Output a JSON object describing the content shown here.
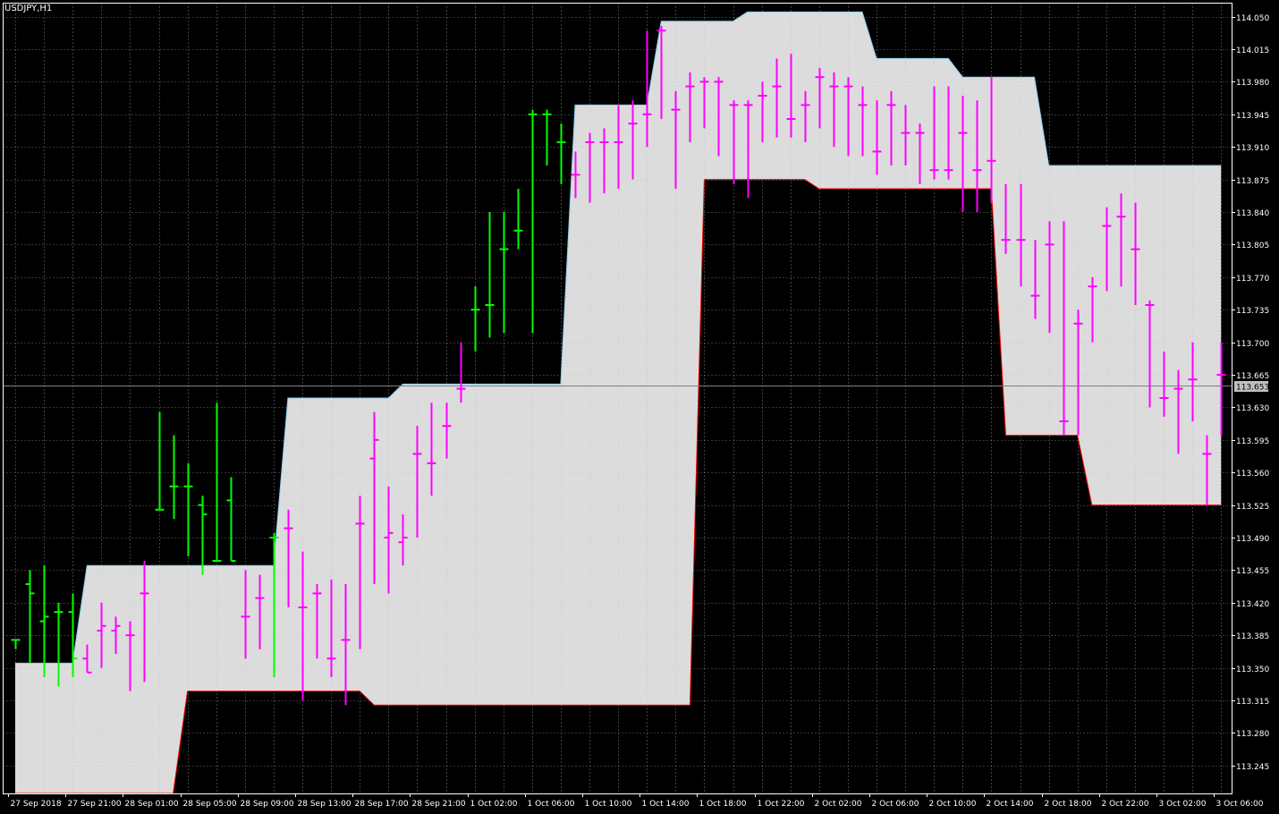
{
  "chart_data": {
    "type": "ohlc",
    "symbol_label": "USDJPY,H1",
    "current_price": 113.653,
    "current_price_label": "113.653",
    "ylim": [
      113.215,
      114.065
    ],
    "y_ticks": [
      "114.050",
      "114.015",
      "113.980",
      "113.945",
      "113.910",
      "113.875",
      "113.840",
      "113.805",
      "113.770",
      "113.735",
      "113.700",
      "113.665",
      "113.630",
      "113.595",
      "113.560",
      "113.525",
      "113.490",
      "113.455",
      "113.420",
      "113.385",
      "113.350",
      "113.315",
      "113.280",
      "113.245"
    ],
    "x_ticks": [
      {
        "bar": 0,
        "label": "27 Sep 2018"
      },
      {
        "bar": 4,
        "label": "27 Sep 21:00"
      },
      {
        "bar": 8,
        "label": "28 Sep 01:00"
      },
      {
        "bar": 12,
        "label": "28 Sep 05:00"
      },
      {
        "bar": 16,
        "label": "28 Sep 09:00"
      },
      {
        "bar": 20,
        "label": "28 Sep 13:00"
      },
      {
        "bar": 24,
        "label": "28 Sep 17:00"
      },
      {
        "bar": 28,
        "label": "28 Sep 21:00"
      },
      {
        "bar": 32,
        "label": "1 Oct 02:00"
      },
      {
        "bar": 36,
        "label": "1 Oct 06:00"
      },
      {
        "bar": 40,
        "label": "1 Oct 10:00"
      },
      {
        "bar": 44,
        "label": "1 Oct 14:00"
      },
      {
        "bar": 48,
        "label": "1 Oct 18:00"
      },
      {
        "bar": 52,
        "label": "1 Oct 22:00"
      },
      {
        "bar": 56,
        "label": "2 Oct 02:00"
      },
      {
        "bar": 60,
        "label": "2 Oct 06:00"
      },
      {
        "bar": 64,
        "label": "2 Oct 10:00"
      },
      {
        "bar": 68,
        "label": "2 Oct 14:00"
      },
      {
        "bar": 72,
        "label": "2 Oct 18:00"
      },
      {
        "bar": 76,
        "label": "2 Oct 22:00"
      },
      {
        "bar": 80,
        "label": "3 Oct 02:00"
      },
      {
        "bar": 84,
        "label": "3 Oct 06:00"
      }
    ],
    "colors": {
      "background": "#000000",
      "grid": "#c0c0c0",
      "band_fill": "#dcdcdc",
      "band_upper_line": "#87ceeb",
      "band_lower_line": "#ff0000",
      "bar_outside": "#00ff00",
      "bar_inside": "#ff00ff",
      "price_line": "#808080",
      "price_tag_bg": "#c0c0c0",
      "text": "#ffffff"
    },
    "bars": [
      {
        "o": 113.38,
        "h": 113.38,
        "l": 113.37,
        "c": 113.38
      },
      {
        "o": 113.44,
        "h": 113.455,
        "l": 113.355,
        "c": 113.43
      },
      {
        "o": 113.4,
        "h": 113.46,
        "l": 113.34,
        "c": 113.405
      },
      {
        "o": 113.41,
        "h": 113.42,
        "l": 113.33,
        "c": 113.41
      },
      {
        "o": 113.41,
        "h": 113.43,
        "l": 113.34,
        "c": 113.36
      },
      {
        "o": 113.36,
        "h": 113.375,
        "l": 113.345,
        "c": 113.345
      },
      {
        "o": 113.39,
        "h": 113.42,
        "l": 113.35,
        "c": 113.395
      },
      {
        "o": 113.39,
        "h": 113.405,
        "l": 113.365,
        "c": 113.395
      },
      {
        "o": 113.385,
        "h": 113.4,
        "l": 113.325,
        "c": 113.385
      },
      {
        "o": 113.43,
        "h": 113.465,
        "l": 113.335,
        "c": 113.43
      },
      {
        "o": 113.52,
        "h": 113.625,
        "l": 113.52,
        "c": 113.52
      },
      {
        "o": 113.545,
        "h": 113.6,
        "l": 113.51,
        "c": 113.545
      },
      {
        "o": 113.545,
        "h": 113.57,
        "l": 113.47,
        "c": 113.545
      },
      {
        "o": 113.525,
        "h": 113.535,
        "l": 113.45,
        "c": 113.515
      },
      {
        "o": 113.465,
        "h": 113.635,
        "l": 113.465,
        "c": 113.465
      },
      {
        "o": 113.53,
        "h": 113.555,
        "l": 113.465,
        "c": 113.465
      },
      {
        "o": 113.405,
        "h": 113.455,
        "l": 113.36,
        "c": 113.405
      },
      {
        "o": 113.425,
        "h": 113.45,
        "l": 113.37,
        "c": 113.425
      },
      {
        "o": 113.49,
        "h": 113.495,
        "l": 113.34,
        "c": 113.49
      },
      {
        "o": 113.5,
        "h": 113.52,
        "l": 113.415,
        "c": 113.5
      },
      {
        "o": 113.415,
        "h": 113.475,
        "l": 113.315,
        "c": 113.415
      },
      {
        "o": 113.43,
        "h": 113.44,
        "l": 113.36,
        "c": 113.43
      },
      {
        "o": 113.36,
        "h": 113.445,
        "l": 113.34,
        "c": 113.36
      },
      {
        "o": 113.38,
        "h": 113.44,
        "l": 113.31,
        "c": 113.38
      },
      {
        "o": 113.505,
        "h": 113.535,
        "l": 113.37,
        "c": 113.505
      },
      {
        "o": 113.575,
        "h": 113.625,
        "l": 113.44,
        "c": 113.595
      },
      {
        "o": 113.49,
        "h": 113.545,
        "l": 113.43,
        "c": 113.495
      },
      {
        "o": 113.485,
        "h": 113.515,
        "l": 113.46,
        "c": 113.49
      },
      {
        "o": 113.58,
        "h": 113.61,
        "l": 113.49,
        "c": 113.58
      },
      {
        "o": 113.57,
        "h": 113.635,
        "l": 113.535,
        "c": 113.57
      },
      {
        "o": 113.61,
        "h": 113.635,
        "l": 113.575,
        "c": 113.61
      },
      {
        "o": 113.65,
        "h": 113.7,
        "l": 113.635,
        "c": 113.65
      },
      {
        "o": 113.735,
        "h": 113.76,
        "l": 113.69,
        "c": 113.735
      },
      {
        "o": 113.74,
        "h": 113.84,
        "l": 113.705,
        "c": 113.74
      },
      {
        "o": 113.8,
        "h": 113.84,
        "l": 113.71,
        "c": 113.8
      },
      {
        "o": 113.82,
        "h": 113.865,
        "l": 113.8,
        "c": 113.82
      },
      {
        "o": 113.945,
        "h": 113.95,
        "l": 113.71,
        "c": 113.945
      },
      {
        "o": 113.945,
        "h": 113.95,
        "l": 113.89,
        "c": 113.945
      },
      {
        "o": 113.915,
        "h": 113.935,
        "l": 113.87,
        "c": 113.915
      },
      {
        "o": 113.88,
        "h": 113.905,
        "l": 113.855,
        "c": 113.88
      },
      {
        "o": 113.915,
        "h": 113.925,
        "l": 113.85,
        "c": 113.915
      },
      {
        "o": 113.915,
        "h": 113.93,
        "l": 113.86,
        "c": 113.915
      },
      {
        "o": 113.915,
        "h": 113.955,
        "l": 113.865,
        "c": 113.915
      },
      {
        "o": 113.935,
        "h": 113.96,
        "l": 113.875,
        "c": 113.935
      },
      {
        "o": 113.945,
        "h": 114.035,
        "l": 113.91,
        "c": 113.945
      },
      {
        "o": 114.035,
        "h": 114.04,
        "l": 113.94,
        "c": 114.035
      },
      {
        "o": 113.95,
        "h": 113.97,
        "l": 113.865,
        "c": 113.95
      },
      {
        "o": 113.975,
        "h": 113.99,
        "l": 113.915,
        "c": 113.975
      },
      {
        "o": 113.98,
        "h": 113.985,
        "l": 113.93,
        "c": 113.98
      },
      {
        "o": 113.98,
        "h": 113.985,
        "l": 113.9,
        "c": 113.98
      },
      {
        "o": 113.955,
        "h": 113.96,
        "l": 113.87,
        "c": 113.955
      },
      {
        "o": 113.955,
        "h": 113.96,
        "l": 113.855,
        "c": 113.955
      },
      {
        "o": 113.965,
        "h": 113.98,
        "l": 113.915,
        "c": 113.965
      },
      {
        "o": 113.975,
        "h": 114.005,
        "l": 113.92,
        "c": 113.975
      },
      {
        "o": 113.94,
        "h": 114.01,
        "l": 113.92,
        "c": 113.94
      },
      {
        "o": 113.955,
        "h": 113.97,
        "l": 113.915,
        "c": 113.955
      },
      {
        "o": 113.985,
        "h": 113.995,
        "l": 113.93,
        "c": 113.985
      },
      {
        "o": 113.975,
        "h": 113.99,
        "l": 113.91,
        "c": 113.975
      },
      {
        "o": 113.975,
        "h": 113.985,
        "l": 113.9,
        "c": 113.975
      },
      {
        "o": 113.955,
        "h": 113.975,
        "l": 113.9,
        "c": 113.955
      },
      {
        "o": 113.905,
        "h": 113.96,
        "l": 113.88,
        "c": 113.905
      },
      {
        "o": 113.955,
        "h": 113.97,
        "l": 113.89,
        "c": 113.955
      },
      {
        "o": 113.925,
        "h": 113.955,
        "l": 113.89,
        "c": 113.925
      },
      {
        "o": 113.925,
        "h": 113.935,
        "l": 113.87,
        "c": 113.925
      },
      {
        "o": 113.885,
        "h": 113.975,
        "l": 113.875,
        "c": 113.885
      },
      {
        "o": 113.885,
        "h": 113.975,
        "l": 113.875,
        "c": 113.885
      },
      {
        "o": 113.925,
        "h": 113.965,
        "l": 113.84,
        "c": 113.925
      },
      {
        "o": 113.885,
        "h": 113.96,
        "l": 113.84,
        "c": 113.885
      },
      {
        "o": 113.895,
        "h": 113.985,
        "l": 113.85,
        "c": 113.895
      },
      {
        "o": 113.81,
        "h": 113.87,
        "l": 113.795,
        "c": 113.81
      },
      {
        "o": 113.81,
        "h": 113.87,
        "l": 113.76,
        "c": 113.81
      },
      {
        "o": 113.75,
        "h": 113.81,
        "l": 113.725,
        "c": 113.75
      },
      {
        "o": 113.805,
        "h": 113.83,
        "l": 113.71,
        "c": 113.805
      },
      {
        "o": 113.615,
        "h": 113.83,
        "l": 113.6,
        "c": 113.615
      },
      {
        "o": 113.72,
        "h": 113.735,
        "l": 113.6,
        "c": 113.72
      },
      {
        "o": 113.76,
        "h": 113.77,
        "l": 113.7,
        "c": 113.76
      },
      {
        "o": 113.825,
        "h": 113.845,
        "l": 113.755,
        "c": 113.825
      },
      {
        "o": 113.835,
        "h": 113.86,
        "l": 113.76,
        "c": 113.835
      },
      {
        "o": 113.8,
        "h": 113.85,
        "l": 113.74,
        "c": 113.8
      },
      {
        "o": 113.74,
        "h": 113.745,
        "l": 113.63,
        "c": 113.74
      },
      {
        "o": 113.64,
        "h": 113.69,
        "l": 113.62,
        "c": 113.64
      },
      {
        "o": 113.65,
        "h": 113.67,
        "l": 113.58,
        "c": 113.65
      },
      {
        "o": 113.66,
        "h": 113.7,
        "l": 113.615,
        "c": 113.66
      },
      {
        "o": 113.58,
        "h": 113.6,
        "l": 113.525,
        "c": 113.58
      },
      {
        "o": 113.665,
        "h": 113.7,
        "l": 113.6,
        "c": 113.665
      }
    ],
    "band": {
      "upper": [
        [
          0,
          113.355
        ],
        [
          4,
          113.355
        ],
        [
          5,
          113.46
        ],
        [
          18,
          113.46
        ],
        [
          19,
          113.64
        ],
        [
          26,
          113.64
        ],
        [
          27,
          113.655
        ],
        [
          38,
          113.655
        ],
        [
          39,
          113.955
        ],
        [
          44,
          113.955
        ],
        [
          45,
          114.045
        ],
        [
          50,
          114.045
        ],
        [
          51,
          114.055
        ],
        [
          59,
          114.055
        ],
        [
          60,
          114.005
        ],
        [
          65,
          114.005
        ],
        [
          66,
          113.985
        ],
        [
          71,
          113.985
        ],
        [
          72,
          113.89
        ],
        [
          84,
          113.89
        ]
      ],
      "lower": [
        [
          0,
          113.155
        ],
        [
          11,
          113.155
        ],
        [
          12,
          113.325
        ],
        [
          24,
          113.325
        ],
        [
          25,
          113.31
        ],
        [
          47,
          113.31
        ],
        [
          48,
          113.875
        ],
        [
          55,
          113.875
        ],
        [
          56,
          113.865
        ],
        [
          68,
          113.865
        ],
        [
          69,
          113.6
        ],
        [
          74,
          113.6
        ],
        [
          75,
          113.525
        ],
        [
          84,
          113.525
        ]
      ]
    }
  }
}
